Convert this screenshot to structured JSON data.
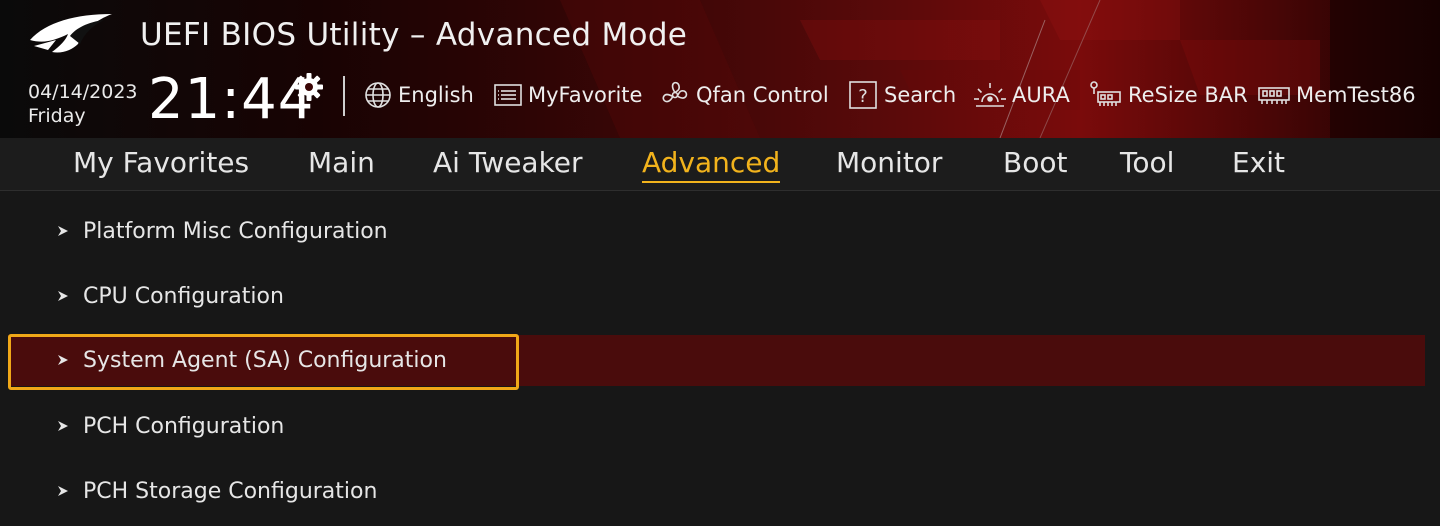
{
  "header": {
    "title": "UEFI BIOS Utility – Advanced Mode",
    "date": "04/14/2023",
    "day": "Friday",
    "time": "21:44"
  },
  "toolbar": [
    {
      "label": "English",
      "icon": "globe-icon"
    },
    {
      "label": "MyFavorite",
      "icon": "favorite-list-icon"
    },
    {
      "label": "Qfan Control",
      "icon": "fan-icon"
    },
    {
      "label": "Search",
      "icon": "question-box-icon"
    },
    {
      "label": "AURA",
      "icon": "aura-light-icon"
    },
    {
      "label": "ReSize BAR",
      "icon": "resize-bar-icon"
    },
    {
      "label": "MemTest86",
      "icon": "memory-icon"
    }
  ],
  "tabs": [
    {
      "label": "My Favorites",
      "active": false
    },
    {
      "label": "Main",
      "active": false
    },
    {
      "label": "Ai Tweaker",
      "active": false
    },
    {
      "label": "Advanced",
      "active": true
    },
    {
      "label": "Monitor",
      "active": false
    },
    {
      "label": "Boot",
      "active": false
    },
    {
      "label": "Tool",
      "active": false
    },
    {
      "label": "Exit",
      "active": false
    }
  ],
  "menu": [
    {
      "label": "Platform Misc Configuration",
      "selected": false
    },
    {
      "label": "CPU Configuration",
      "selected": false
    },
    {
      "label": "System Agent (SA) Configuration",
      "selected": true
    },
    {
      "label": "PCH Configuration",
      "selected": false
    },
    {
      "label": "PCH Storage Configuration",
      "selected": false
    }
  ],
  "colors": {
    "accent": "#f2b31c",
    "selection": "#4a0c0c",
    "background": "#171717"
  }
}
